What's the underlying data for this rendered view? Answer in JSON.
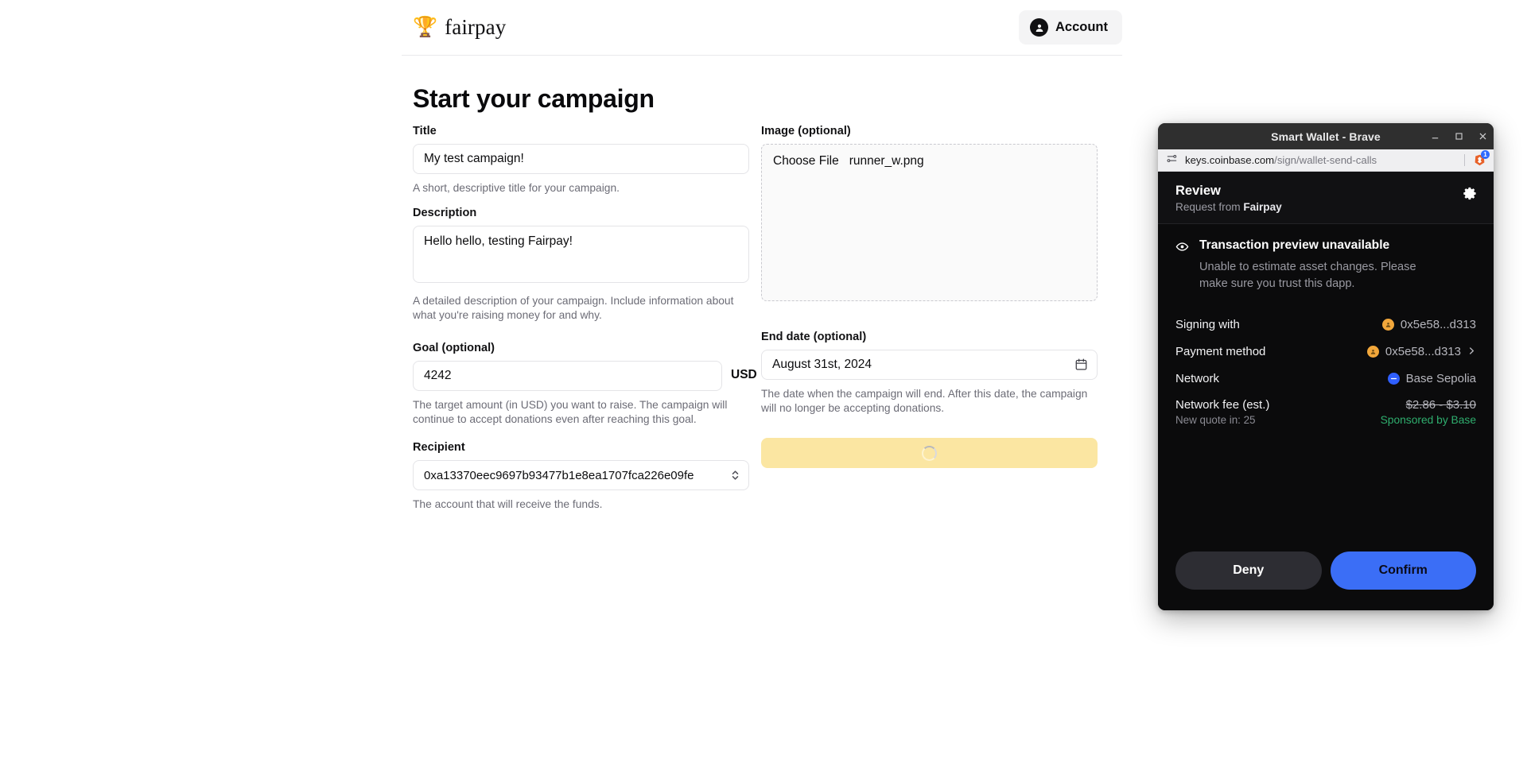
{
  "header": {
    "brand_emoji": "🏆",
    "brand_name": "fairpay",
    "account_label": "Account",
    "account_icon": "user-circle-icon"
  },
  "page": {
    "title": "Start your campaign"
  },
  "form": {
    "title_field": {
      "label": "Title",
      "value": "My test campaign!",
      "placeholder": "",
      "help": "A short, descriptive title for your campaign."
    },
    "description_field": {
      "label": "Description",
      "value": "Hello hello, testing Fairpay!",
      "placeholder": "",
      "help": "A detailed description of your campaign. Include information about what you're raising money for and why."
    },
    "goal_field": {
      "label": "Goal (optional)",
      "value": "4242",
      "unit": "USD",
      "help": "The target amount (in USD) you want to raise. The campaign will continue to accept donations even after reaching this goal."
    },
    "recipient_field": {
      "label": "Recipient",
      "value": "0xa13370eec9697b93477b1e8ea1707fca226e09fe",
      "help": "The account that will receive the funds."
    },
    "image_field": {
      "label": "Image (optional)",
      "choose_label": "Choose File",
      "file_name": "runner_w.png"
    },
    "end_date_field": {
      "label": "End date (optional)",
      "value": "August 31st, 2024",
      "help": "The date when the campaign will end. After this date, the campaign will no longer be accepting donations."
    },
    "submit": {
      "label": "",
      "state": "loading",
      "color": "#fbe6a2"
    }
  },
  "wallet": {
    "window_title": "Smart Wallet - Brave",
    "url_host": "keys.coinbase.com",
    "url_path": "/sign/wallet-send-calls",
    "extension_badge_count": "1",
    "review_title": "Review",
    "review_request_prefix": "Request from ",
    "review_request_app": "Fairpay",
    "alert_title": "Transaction preview unavailable",
    "alert_body": "Unable to estimate asset changes. Please make sure you trust this dapp.",
    "rows": [
      {
        "label": "Signing with",
        "value": "0x5e58...d313",
        "icon": "avatar-chip-icon",
        "chevron": false
      },
      {
        "label": "Payment method",
        "value": "0x5e58...d313",
        "icon": "avatar-chip-icon",
        "chevron": true
      },
      {
        "label": "Network",
        "value": "Base Sepolia",
        "icon": "base-network-icon",
        "chevron": false
      }
    ],
    "fee_label": "Network fee (est.)",
    "fee_value": "$2.86 - $3.10",
    "quote_label": "New quote in: 25",
    "sponsor_label": "Sponsored by Base",
    "deny_label": "Deny",
    "confirm_label": "Confirm",
    "accent_confirm": "#3b6ef6",
    "accent_sponsor": "#2fae6e"
  }
}
